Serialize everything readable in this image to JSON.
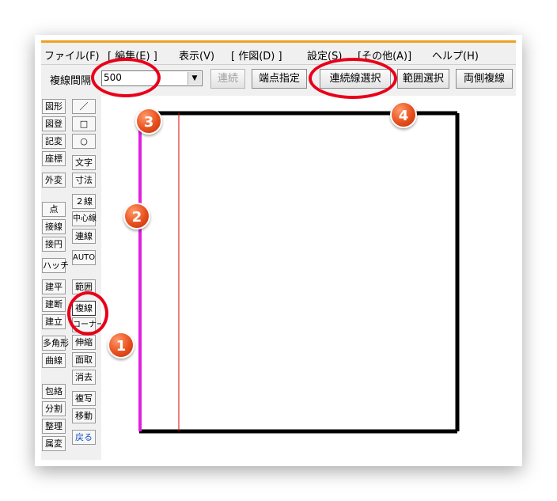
{
  "menu": [
    "ファイル(F)",
    "[ 編集(E) ]",
    "表示(V)",
    "[ 作図(D) ]",
    "設定(S)",
    "[その他(A)]",
    "ヘルプ(H)"
  ],
  "toolbar": {
    "line_spacing_label": "複線間隔",
    "line_spacing_value": "500",
    "buttons": [
      "連続",
      "端点指定",
      "連続線選択",
      "範囲選択",
      "両側複線"
    ]
  },
  "left_panel": {
    "col1": [
      "図形",
      "図登",
      "記変",
      "座標",
      "外変",
      "点",
      "接線",
      "接円",
      "ハッチ",
      "建平",
      "建断",
      "建立",
      "多角形",
      "曲線",
      "包絡",
      "分割",
      "整理",
      "属変"
    ],
    "col2": [
      "／",
      "□",
      "○",
      "文字",
      "寸法",
      "２線",
      "中心線",
      "連線",
      "AUTO",
      "範囲",
      "複線",
      "コーナー",
      "伸縮",
      "面取",
      "消去",
      "複写",
      "移動",
      "戻る"
    ]
  },
  "markers": [
    "1",
    "2",
    "3",
    "4"
  ],
  "colors": {
    "accent": "#f0a020",
    "selected_line": "#e020e0",
    "offset_line": "#e00000",
    "highlight": "#e8001a",
    "marker": "#e8501e"
  }
}
